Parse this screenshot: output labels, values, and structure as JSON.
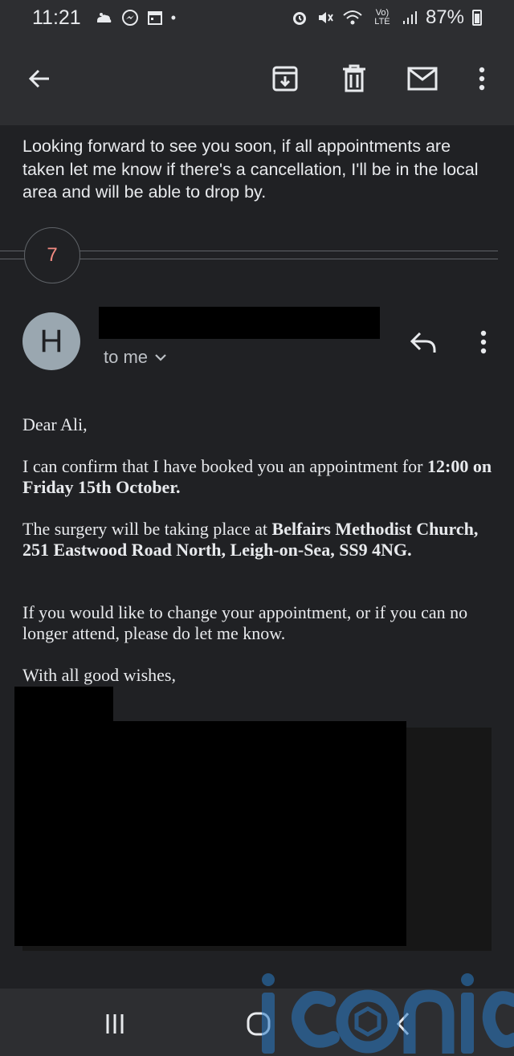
{
  "status_bar": {
    "time": "11:21",
    "network": "Vo) LTE",
    "battery_percent": "87%"
  },
  "toolbar": {
    "back_icon": "arrow-left-icon",
    "archive_icon": "archive-icon",
    "delete_icon": "trash-icon",
    "mark_unread_icon": "mail-icon",
    "more_icon": "more-vertical-icon"
  },
  "previous_message": {
    "text": "Looking forward to see you soon, if all appointments are taken let me know if there's a cancellation, I'll be in the local area and will be able to drop by."
  },
  "collapsed": {
    "count": "7"
  },
  "message": {
    "avatar_letter": "H",
    "recipient": "to me",
    "greeting": "Dear Ali,",
    "para1_start": "I can confirm that I have booked you an appointment for ",
    "para1_bold": "12:00 on Friday 15th October.",
    "para2_start": "The surgery will be taking place at ",
    "para2_bold": "Belfairs Methodist Church,  251 Eastwood Road North, Leigh-on-Sea, SS9 4NG.",
    "para3": "If you would like to change your appointment, or if you can no longer attend, please do let me know.",
    "signoff": "With all good wishes,"
  },
  "watermark": {
    "text": "iconic"
  },
  "colors": {
    "background": "#202124",
    "bar": "#2d2e31",
    "count_accent": "#f28b82",
    "avatar": "#9aa7b0"
  }
}
